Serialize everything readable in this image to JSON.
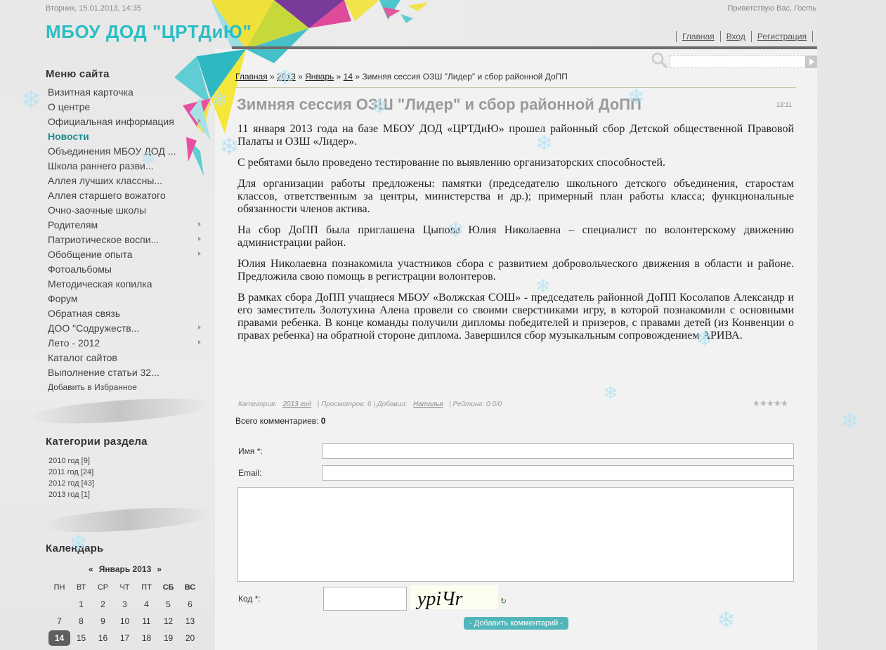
{
  "header": {
    "date": "Вторник, 15.01.2013, 14:35",
    "site_title": "МБОУ ДОД \"ЦРТДиЮ\"",
    "welcome": "Приветствую Вас,",
    "welcome_user": "Гость",
    "nav": [
      "Главная",
      "Вход",
      "Регистрация"
    ]
  },
  "search": {
    "placeholder": ""
  },
  "sidebar": {
    "menu_title": "Меню сайта",
    "menu": [
      {
        "label": "Визитная карточка",
        "arrow": false
      },
      {
        "label": "О центре",
        "arrow": false
      },
      {
        "label": "Официальная информация",
        "arrow": true
      },
      {
        "label": "Новости",
        "arrow": false,
        "active": true
      },
      {
        "label": "Объединения МБОУ ДОД ...",
        "arrow": false
      },
      {
        "label": "Школа раннего разви...",
        "arrow": false
      },
      {
        "label": "Аллея лучших классны...",
        "arrow": false
      },
      {
        "label": "Аллея старшего вожатого",
        "arrow": false
      },
      {
        "label": "Очно-заочные школы",
        "arrow": false
      },
      {
        "label": "Родителям",
        "arrow": true
      },
      {
        "label": "Патриотическое воспи...",
        "arrow": true
      },
      {
        "label": "Обобщение опыта",
        "arrow": true
      },
      {
        "label": "Фотоальбомы",
        "arrow": false
      },
      {
        "label": "Методическая копилка",
        "arrow": false
      },
      {
        "label": "Форум",
        "arrow": false
      },
      {
        "label": "Обратная связь",
        "arrow": false
      },
      {
        "label": "ДОО \"Содружеств...",
        "arrow": true
      },
      {
        "label": "Лето - 2012",
        "arrow": true
      },
      {
        "label": "Каталог сайтов",
        "arrow": false
      },
      {
        "label": "Выполнение статьи 32...",
        "arrow": false
      },
      {
        "label": "Добавить в Избранное",
        "arrow": false,
        "small": true
      }
    ],
    "categories_title": "Категории раздела",
    "categories": [
      "2010 год [9]",
      "2011 год [24]",
      "2012 год [43]",
      "2013 год [1]"
    ],
    "calendar_title": "Календарь",
    "calendar": {
      "prev": "«",
      "month": "Январь 2013",
      "next": "»",
      "weekdays": [
        "ПН",
        "ВТ",
        "СР",
        "ЧТ",
        "ПТ",
        "СБ",
        "ВС"
      ],
      "weeks": [
        [
          "",
          "1",
          "2",
          "3",
          "4",
          "5",
          "6"
        ],
        [
          "7",
          "8",
          "9",
          "10",
          "11",
          "12",
          "13"
        ],
        [
          "14",
          "15",
          "16",
          "17",
          "18",
          "19",
          "20"
        ]
      ],
      "today": "14"
    }
  },
  "breadcrumb": {
    "items": [
      "Главная",
      "2013",
      "Январь",
      "14"
    ],
    "sep": "»",
    "current": "Зимняя сессия ОЗШ \"Лидер\" и сбор районной ДоПП"
  },
  "article": {
    "title": "Зимняя сессия ОЗШ \"Лидер\" и сбор районной ДоПП",
    "time": "13:11",
    "paragraphs": [
      "11 января 2013 года на базе МБОУ ДОД «ЦРТДиЮ» прошел районный сбор Детской общественной Правовой Палаты и ОЗШ «Лидер».",
      "С ребятами было проведено тестирование по выявлению организаторских способностей.",
      "Для организации работы предложены: памятки (председателю школьного детского объединения, старостам классов, ответственным за центры, министерства и др.); примерный план работы класса; функциональные обязанности членов актива.",
      "На сбор ДоПП была приглашена Цыпова Юлия Николаевна – специалист по волонтерскому движению администрации район.",
      "Юлия Николаевна познакомила участников сбора с развитием добровольческого движения в области и районе. Предложила свою помощь в регистрации волонтеров.",
      "В рамках сбора ДоПП учащиеся МБОУ «Волжская СОШ» - председатель районной ДоПП Косолапов Александр и его заместитель Золотухина Алена провели со своими сверстниками игру, в которой познакомили с основными правами ребенка. В конце команды получили дипломы победителей и призеров, с правами детей  (из Конвенции о правах ребенка) на обратной стороне диплома. Завершился сбор музыкальным сопровождением АРИВА."
    ],
    "meta": {
      "category_label": "Категория:",
      "category": "2013 год",
      "views": "| Просмотров: 6 | Добавил:",
      "author": "Наталья",
      "rating": "| Рейтинг: 0.0/0"
    },
    "stars": 5
  },
  "comments": {
    "count_label": "Всего комментариев:",
    "count": "0",
    "name_label": "Имя *:",
    "email_label": "Email:",
    "code_label": "Код *:",
    "captcha_text": "ypiЧr",
    "refresh_icon": "↻",
    "submit_label": "- Добавить комментарий -"
  },
  "colors": {
    "accent": "#2bbdc4",
    "active_menu": "#1e8b8f",
    "button": "#52b5b9",
    "today": "#5f5f5f"
  }
}
